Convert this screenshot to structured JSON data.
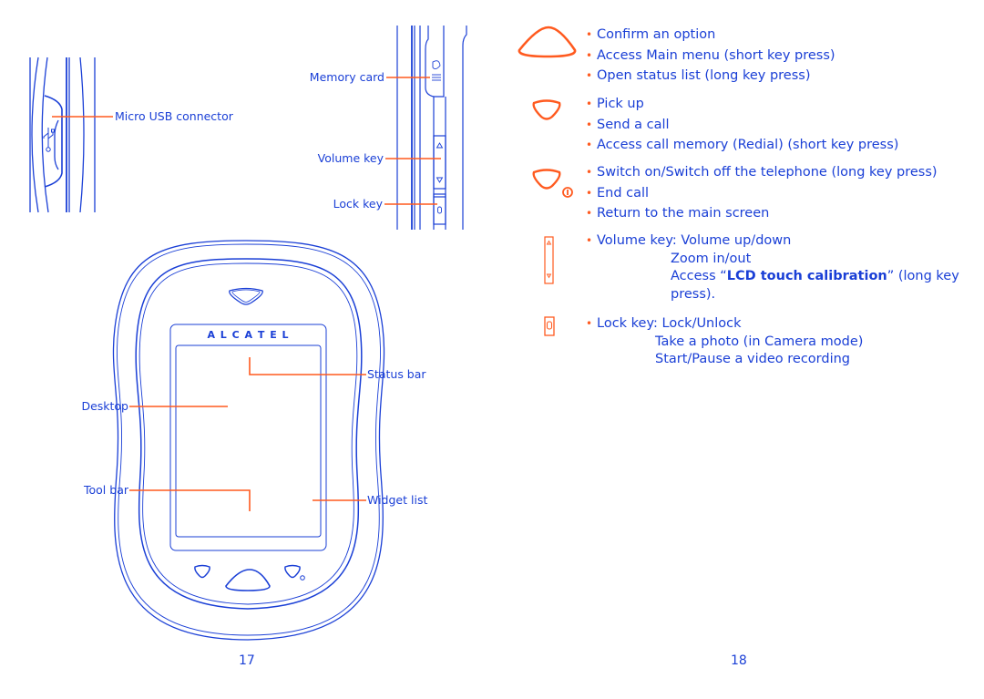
{
  "colors": {
    "ink": "#1a3fd6",
    "accent": "#ff5a1f",
    "background": "#ffffff"
  },
  "left_page": {
    "page_number": "17",
    "side_left_labels": {
      "micro_usb": "Micro USB connector"
    },
    "side_right_labels": {
      "memory_card": "Memory card",
      "volume_key": "Volume key",
      "lock_key": "Lock key"
    },
    "front_labels": {
      "brand": "A L C A T E L",
      "status_bar": "Status bar",
      "desktop": "Desktop",
      "tool_bar": "Tool bar",
      "widget_list": "Widget list"
    },
    "icons": [
      "usb-port-icon",
      "microsd-icon",
      "volume-up-arrow-icon",
      "volume-down-arrow-icon",
      "lock-key-icon",
      "center-key-icon",
      "pick-up-key-icon",
      "end-key-icon",
      "power-icon"
    ]
  },
  "right_page": {
    "page_number": "18",
    "sections": [
      {
        "icon": "center-navigation-key-icon",
        "items": [
          "Confirm an option",
          "Access Main menu (short key press)",
          "Open status list (long key press)"
        ]
      },
      {
        "icon": "pick-up-key-icon",
        "items": [
          "Pick up",
          "Send a call",
          "Access call memory (Redial) (short key press)"
        ]
      },
      {
        "icon": "end-key-power-icon",
        "items": [
          "Switch on/Switch off the telephone (long key press)",
          "End call",
          "Return to the main screen"
        ]
      },
      {
        "icon": "volume-key-icon",
        "prefix": "Volume key: ",
        "lines": [
          "Volume up/down",
          "Zoom in/out"
        ],
        "calib_pre": "Access “",
        "calib_bold": "LCD touch calibration",
        "calib_post": "” (long key",
        "calib_wrap": "press)."
      },
      {
        "icon": "lock-key-icon",
        "prefix": "Lock key: ",
        "lines": [
          "Lock/Unlock",
          "Take a photo (in Camera mode)",
          "Start/Pause a video recording"
        ]
      }
    ]
  }
}
